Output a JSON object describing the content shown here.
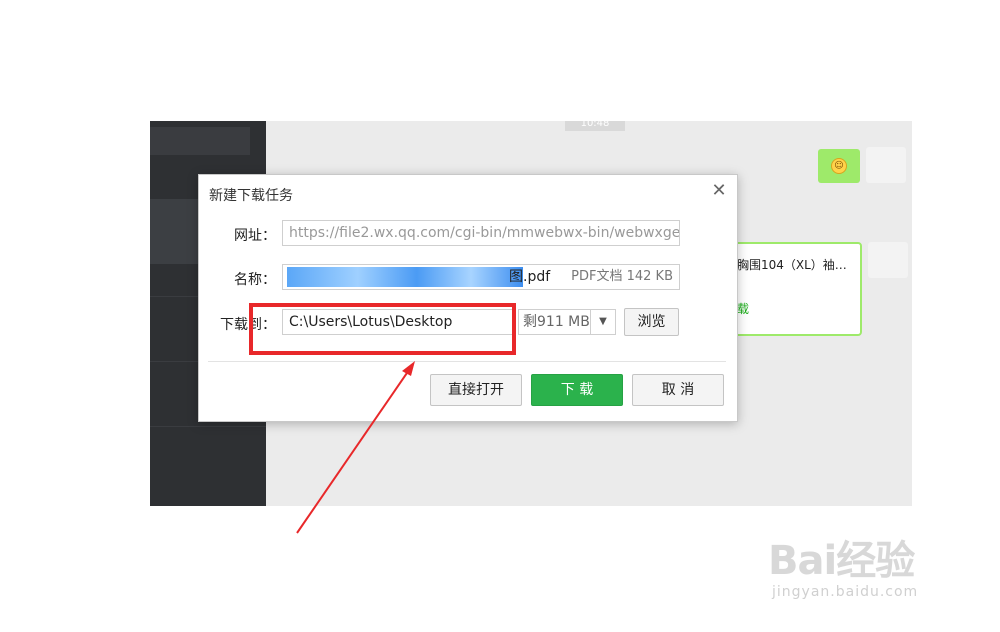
{
  "background_app": {
    "timestamp": "10:48",
    "file_card": {
      "name": "胸围104（XL）袖…",
      "action": "载"
    }
  },
  "dialog": {
    "title": "新建下载任务",
    "url_label": "网址：",
    "url_value": "https://file2.wx.qq.com/cgi-bin/mmwebwx-bin/webwxgeti",
    "name_label": "名称：",
    "name_visible_suffix": "图.pdf",
    "name_meta": "PDF文档 142 KB",
    "save_to_label": "下载到：",
    "save_path": "C:\\Users\\Lotus\\Desktop",
    "free_space": "剩911 MB",
    "browse_button": "浏览",
    "open_button": "直接打开",
    "download_button": "下 载",
    "cancel_button": "取 消"
  },
  "watermark": {
    "logo": "Bai经验",
    "sub": "jingyan.baidu.com"
  },
  "colors": {
    "accent_green": "#2bb24c",
    "annotation_red": "#e8282a",
    "sidebar_dark": "#2e3033",
    "bubble_green": "#9eea6a"
  }
}
